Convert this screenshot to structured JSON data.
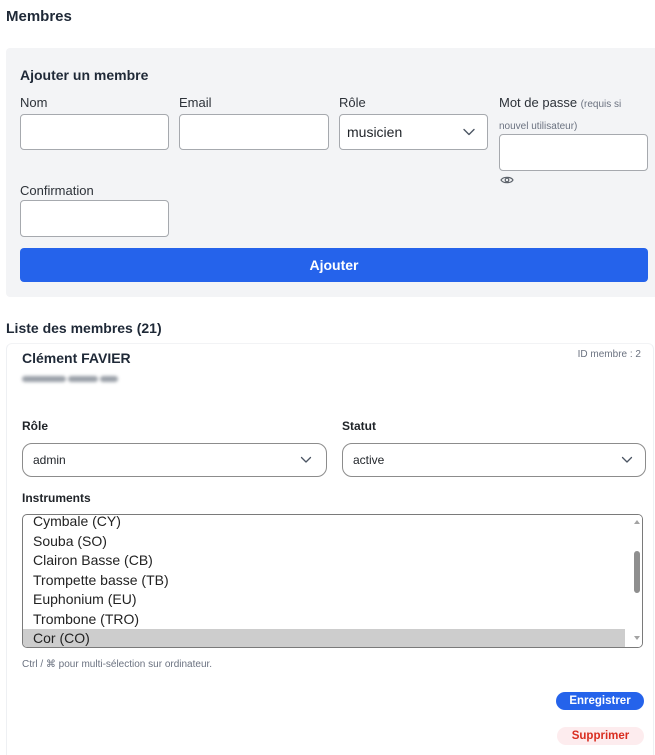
{
  "colors": {
    "accent": "#2563eb",
    "panel_bg": "#f3f4f6",
    "danger": "#d92d20",
    "danger_bg": "#fdecee",
    "selected_option_bg": "#cdcdcd"
  },
  "page": {
    "title": "Membres"
  },
  "add_form": {
    "title": "Ajouter un membre",
    "name": {
      "label": "Nom",
      "value": ""
    },
    "email": {
      "label": "Email",
      "value": ""
    },
    "role": {
      "label": "Rôle",
      "value": "musicien",
      "icon": "chevron-down-icon"
    },
    "password": {
      "label": "Mot de passe",
      "hint": "(requis si nouvel utilisateur)",
      "value": "",
      "toggle_icon": "eye-icon"
    },
    "confirmation": {
      "label": "Confirmation",
      "value": ""
    },
    "submit_label": "Ajouter"
  },
  "members_list": {
    "title": "Liste des membres (21)",
    "members": [
      {
        "name": "Clément FAVIER",
        "id_label": "ID membre : 2",
        "role": {
          "label": "Rôle",
          "value": "admin",
          "icon": "chevron-down-icon"
        },
        "status": {
          "label": "Statut",
          "value": "active",
          "icon": "chevron-down-icon"
        },
        "instruments": {
          "label": "Instruments",
          "options": [
            {
              "label": "Cymbale (CY)",
              "selected": false
            },
            {
              "label": "Souba (SO)",
              "selected": false
            },
            {
              "label": "Clairon Basse (CB)",
              "selected": false
            },
            {
              "label": "Trompette basse (TB)",
              "selected": false
            },
            {
              "label": "Euphonium (EU)",
              "selected": false
            },
            {
              "label": "Trombone (TRO)",
              "selected": false
            },
            {
              "label": "Cor (CO)",
              "selected": true
            }
          ],
          "hint": "Ctrl / ⌘ pour multi-sélection sur ordinateur."
        },
        "save_label": "Enregistrer",
        "delete_label": "Supprimer"
      }
    ]
  }
}
